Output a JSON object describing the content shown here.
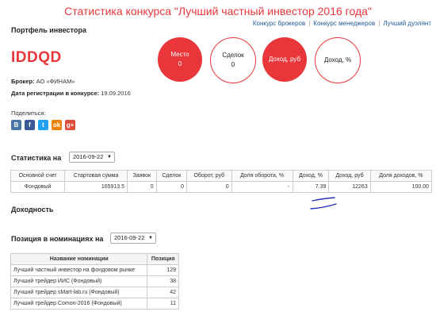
{
  "page_title": "Статистика конкурса \"Лучший частный инвестор 2016 года\"",
  "top_links": [
    "Конкурс брокеров",
    "Конкурс менеджеров",
    "Лучший дуэлянт"
  ],
  "portfolio": {
    "heading": "Портфель инвестора",
    "ticker": "IDDQD",
    "broker_label": "Брокер:",
    "broker_value": "АО «ФИНАМ»",
    "reg_label": "Дата регистрации в конкурсе:",
    "reg_value": "19.09.2016"
  },
  "circles": [
    {
      "label": "Место",
      "value": "0",
      "style": "red"
    },
    {
      "label": "Сделок",
      "value": "0",
      "style": "white"
    },
    {
      "label": "Доход, руб",
      "value": "",
      "style": "red"
    },
    {
      "label": "Доход, %",
      "value": "",
      "style": "white"
    }
  ],
  "share": {
    "label": "Поделиться:",
    "icons": [
      {
        "name": "vk-icon",
        "glyph": "B",
        "color": "#4a76a8"
      },
      {
        "name": "facebook-icon",
        "glyph": "f",
        "color": "#3b5998"
      },
      {
        "name": "twitter-icon",
        "glyph": "t",
        "color": "#1da1f2"
      },
      {
        "name": "odnoklassniki-icon",
        "glyph": "ok",
        "color": "#ee8208"
      },
      {
        "name": "google-plus-icon",
        "glyph": "g+",
        "color": "#dd4b39"
      }
    ]
  },
  "stats": {
    "heading": "Статистика на",
    "date_select": "2016-09-22",
    "headers": [
      "Основной счет",
      "Стартовая сумма",
      "Заявок",
      "Сделок",
      "Оборот, руб",
      "Доля оборота, %",
      "Доход, %",
      "Доход, руб",
      "Доля доходов, %"
    ],
    "rows": [
      [
        "Фондовый",
        "165913.5",
        "0",
        "0",
        "0",
        "-",
        "7.39",
        "12263",
        "100.00"
      ]
    ]
  },
  "yield_heading": "Доходность",
  "nominations": {
    "heading": "Позиция в номинациях на",
    "date_select": "2016-09-22",
    "headers": [
      "Название номинации",
      "Позиция"
    ],
    "rows": [
      [
        "Лучший частный инвестор на фондовом рынке",
        "129"
      ],
      [
        "Лучший трейдер ИИС (Фондовый)",
        "38"
      ],
      [
        "Лучший трейдер sMart-lab.ru (Фондовый)",
        "42"
      ],
      [
        "Лучший трейдер Comon-2016 (Фондовый)",
        "11"
      ]
    ]
  },
  "colors": {
    "accent": "#e8363a",
    "link": "#1f5a98",
    "annotation": "#2233bb"
  }
}
